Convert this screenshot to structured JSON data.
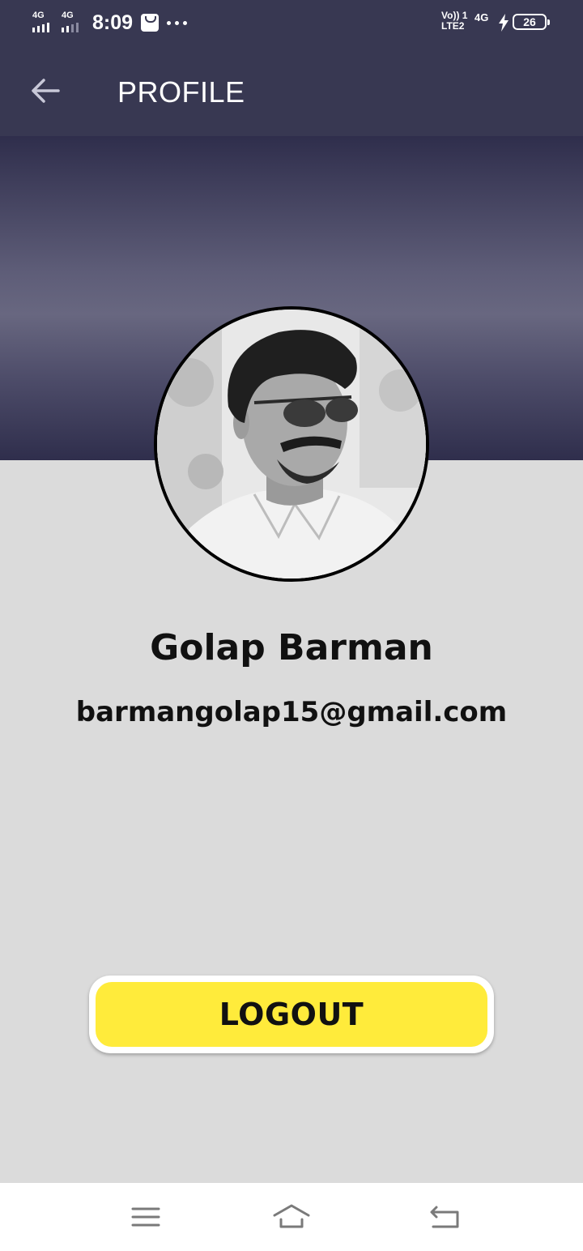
{
  "status_bar": {
    "sim1_network": "4G",
    "sim2_network": "4G",
    "time": "8:09",
    "volte_line1": "Vo)) 1",
    "volte_line2": "LTE2",
    "network_right": "4G",
    "battery_level": "26",
    "icons": [
      "signal-icon",
      "signal-icon",
      "shopping-bag-icon",
      "more-icon",
      "volte-icon",
      "charging-bolt-icon",
      "battery-icon"
    ]
  },
  "app_bar": {
    "title": "PROFILE",
    "back_icon": "arrow-left-icon"
  },
  "profile": {
    "name": "Golap Barman",
    "email": "barmangolap15@gmail.com"
  },
  "actions": {
    "logout_label": "LOGOUT",
    "logout_color": "#ffeb3b"
  },
  "nav_bar": {
    "icons": [
      "menu-icon",
      "home-icon",
      "back-icon"
    ]
  },
  "colors": {
    "header": "#383852",
    "background": "#dbdbdb"
  }
}
